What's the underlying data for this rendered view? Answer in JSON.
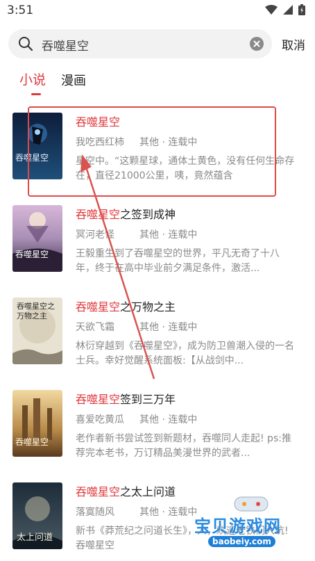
{
  "status_bar": {
    "time": "3:51"
  },
  "search": {
    "query": "吞噬星空",
    "cancel_label": "取消"
  },
  "tabs": [
    {
      "label": "小说",
      "active": true
    },
    {
      "label": "漫画",
      "active": false
    }
  ],
  "highlight_term": "吞噬星空",
  "books": [
    {
      "title_highlight": "吞噬星空",
      "title_rest": "",
      "author": "我吃西红柿",
      "meta": "其他 · 连载中",
      "desc": "星空中。“这颗星球，通体土黄色，没有任何生命存在，直径21000公里，咦，竟然蕴含",
      "cover_text": "吞噬星空"
    },
    {
      "title_highlight": "吞噬星空",
      "title_rest": "之签到成神",
      "author": "冥河老怪",
      "meta": "其他 · 连载中",
      "desc": "王毅重生到了吞噬星空的世界，平凡无奇了十八年，终于在高中毕业前夕满足条件，激活...",
      "cover_text": "吞噬星空"
    },
    {
      "title_highlight": "吞噬星空",
      "title_rest": "之万物之主",
      "author": "天欲飞霜",
      "meta": "其他 · 连载中",
      "desc": "林衍穿越到《吞噬星空》，成为防卫兽潮入侵的一名士兵。幸好觉醒系统面板:【从战剑中...",
      "cover_text": "吞噬星空之万物之主"
    },
    {
      "title_highlight": "吞噬星空",
      "title_rest": "签到三万年",
      "author": "喜爱吃黄瓜",
      "meta": "其他 · 连载中",
      "desc": "老作者新书尝试签到新题材，吞噬同人走起! ps:推荐完本老书，万订精品美漫世界的武者...",
      "cover_text": "吞噬星空"
    },
    {
      "title_highlight": "吞噬星空",
      "title_rest": "之太上问道",
      "author": "落寞随风",
      "meta": "其他 · 连载中",
      "desc": "新书《莽荒纪之问道长生》，人，欢迎老铁们入坑! 吞噬星空",
      "cover_text": "太上问道"
    }
  ],
  "watermark": {
    "title": "宝贝游戏网",
    "url": "baobeiy.com"
  },
  "colors": {
    "accent": "#e0393e",
    "annotation": "#e04a4a",
    "watermark": "#2b8be0"
  }
}
